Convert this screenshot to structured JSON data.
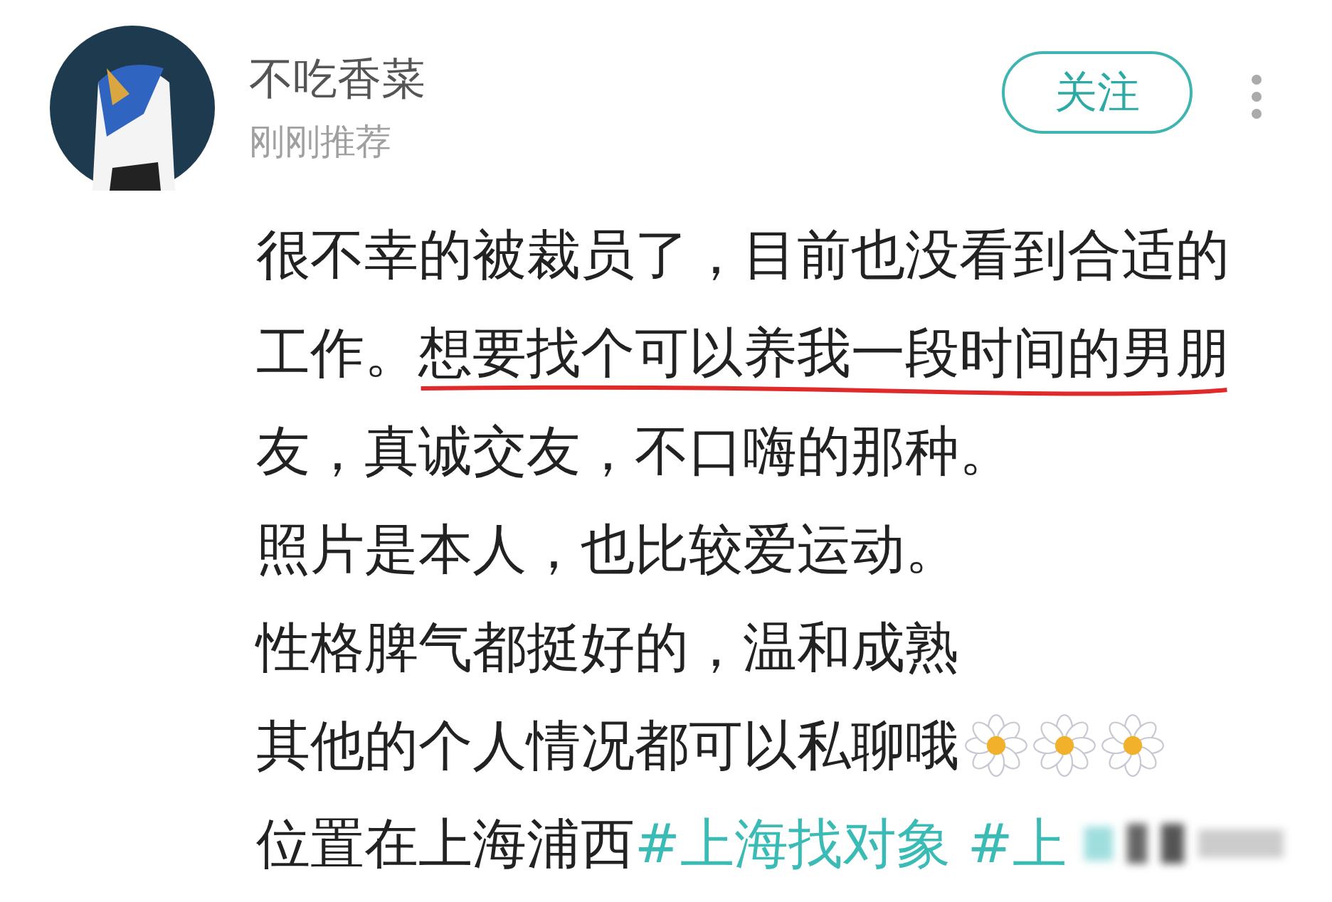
{
  "author": {
    "name": "不吃香菜",
    "subtitle": "刚刚推荐"
  },
  "follow_button": {
    "label": "关注"
  },
  "post_lines": [
    [
      {
        "kind": "text",
        "text": "很不幸的被裁员了，目前也没看到合适的"
      }
    ],
    [
      {
        "kind": "text",
        "text": "工作。"
      },
      {
        "kind": "marked",
        "text": "想要找个可以养我一段时间的男朋"
      }
    ],
    [
      {
        "kind": "text",
        "text": "友，真诚交友，不口嗨的那种。"
      }
    ],
    [
      {
        "kind": "text",
        "text": "照片是本人，也比较爱运动。"
      }
    ],
    [
      {
        "kind": "text",
        "text": "性格脾气都挺好的，温和成熟"
      }
    ],
    [
      {
        "kind": "text",
        "text": "其他的个人情况都可以私聊哦"
      },
      {
        "kind": "flower"
      },
      {
        "kind": "flower"
      },
      {
        "kind": "flower"
      }
    ],
    [
      {
        "kind": "text",
        "text": "位置在上海浦西"
      },
      {
        "kind": "hashtag",
        "text": "#上海找对象"
      },
      {
        "kind": "hashtag",
        "text": "#上"
      },
      {
        "kind": "blurred"
      }
    ]
  ]
}
